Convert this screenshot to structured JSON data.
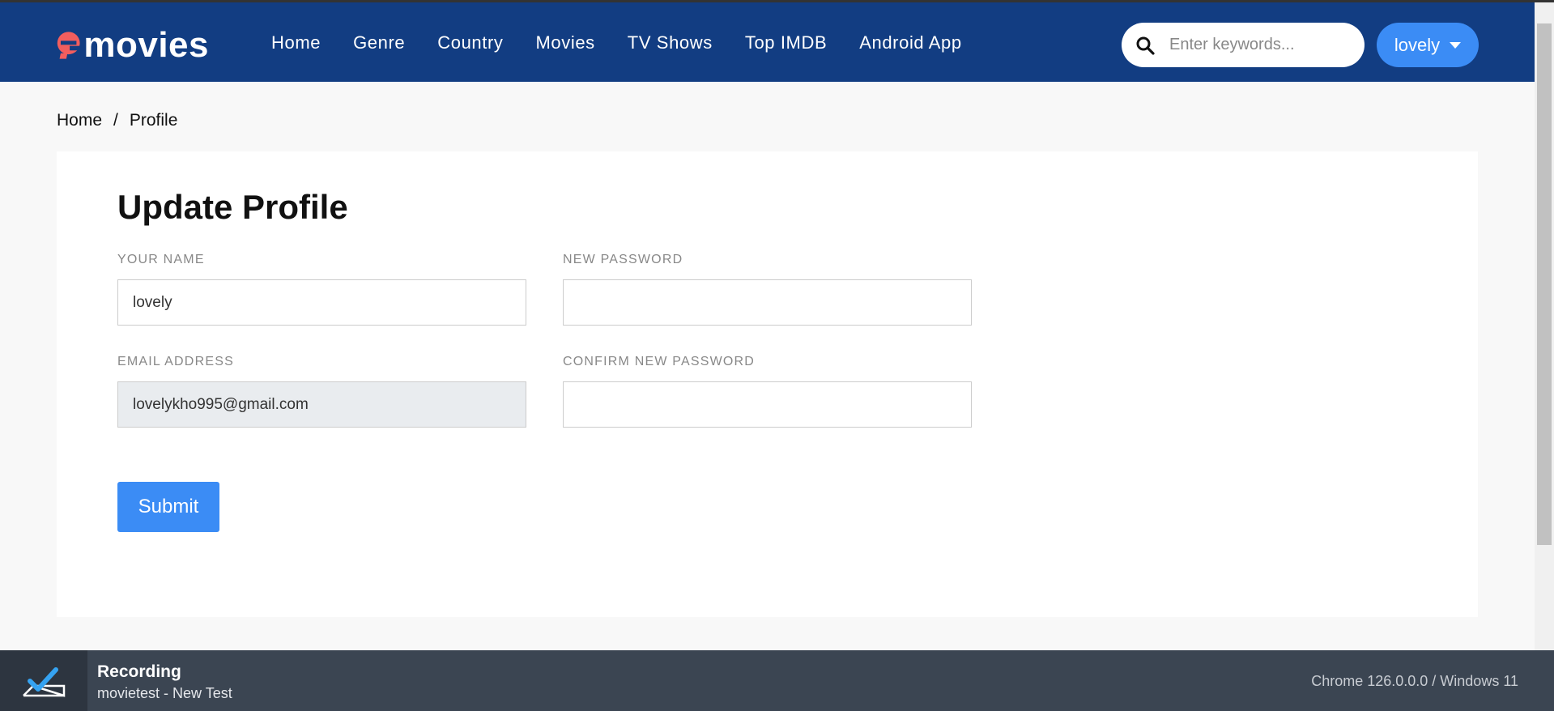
{
  "header": {
    "brand": "movies",
    "nav": [
      "Home",
      "Genre",
      "Country",
      "Movies",
      "TV Shows",
      "Top IMDB",
      "Android App"
    ],
    "search_placeholder": "Enter keywords...",
    "user": "lovely"
  },
  "breadcrumb": {
    "home": "Home",
    "sep": "/",
    "current": "Profile"
  },
  "form": {
    "title": "Update Profile",
    "name_label": "YOUR NAME",
    "name_value": "lovely",
    "email_label": "EMAIL ADDRESS",
    "email_value": "lovelykho995@gmail.com",
    "new_password_label": "NEW PASSWORD",
    "confirm_password_label": "CONFIRM NEW PASSWORD",
    "submit": "Submit"
  },
  "recorder": {
    "title": "Recording",
    "subtitle": "movietest - New Test",
    "env": "Chrome 126.0.0.0 / Windows 11"
  },
  "colors": {
    "header": "#123d82",
    "accent": "#3b8cf5",
    "logo_e": "#f25e5e"
  }
}
